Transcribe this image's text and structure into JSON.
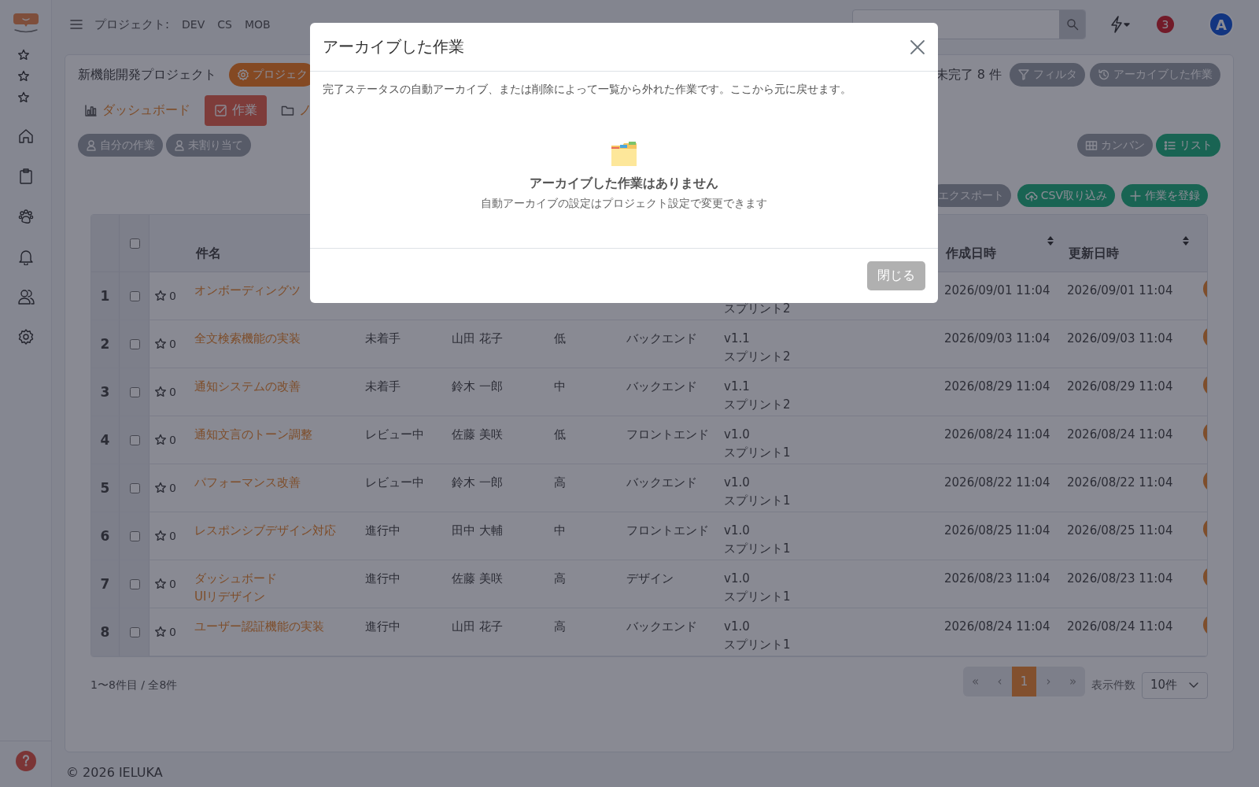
{
  "topbar": {
    "project_label": "プロジェクト:",
    "projects": [
      {
        "label": "DEV"
      },
      {
        "label": "CS"
      },
      {
        "label": "MOB"
      }
    ],
    "notifications": "3",
    "avatar": "A"
  },
  "project": {
    "title": "新機能開発プロジェクト",
    "settings_button": "プロジェク",
    "open_count": "未完了 8 件",
    "actions": [
      {
        "label": "フィルタ",
        "kind": "filter"
      },
      {
        "label": "アーカイブした作業",
        "kind": "archive"
      }
    ]
  },
  "tabs": [
    {
      "label": "ダッシュボード",
      "selected": false
    },
    {
      "label": "作業",
      "selected": true
    },
    {
      "label": "ノ",
      "selected": false
    }
  ],
  "filters": [
    {
      "label": "自分の作業"
    },
    {
      "label": "未割り当て"
    }
  ],
  "views": [
    {
      "label": "カンバン",
      "selected": false
    },
    {
      "label": "リスト",
      "selected": true
    }
  ],
  "toolbar": [
    {
      "label": "エクスポート",
      "kind": "export"
    },
    {
      "label": "CSV取り込み",
      "kind": "import"
    },
    {
      "label": "作業を登録",
      "kind": "create"
    }
  ],
  "table": {
    "header_checked": false,
    "columns": [
      {
        "label": "件名"
      },
      {
        "label": "作成日時",
        "sortable": true
      },
      {
        "label": "更新日時",
        "sortable": true
      }
    ],
    "rows": [
      {
        "number": "1",
        "checked": false,
        "favorites": "0",
        "title": "オンボーディングツ",
        "sprint": "スプリント2",
        "created": "2026/09/01 11:04",
        "updated": "2026/09/01 11:04"
      },
      {
        "number": "2",
        "checked": false,
        "favorites": "0",
        "title": "全文検索機能の実装",
        "status": "未着手",
        "assignee": "山田 花子",
        "priority": "低",
        "category": "バックエンド",
        "version": "v1.1",
        "sprint": "スプリント2",
        "created": "2026/09/03 11:04",
        "updated": "2026/09/03 11:04"
      },
      {
        "number": "3",
        "checked": false,
        "favorites": "0",
        "title": "通知システムの改善",
        "status": "未着手",
        "assignee": "鈴木 一郎",
        "priority": "中",
        "category": "バックエンド",
        "version": "v1.1",
        "sprint": "スプリント2",
        "created": "2026/08/29 11:04",
        "updated": "2026/08/29 11:04"
      },
      {
        "number": "4",
        "checked": false,
        "favorites": "0",
        "title": "通知文言のトーン調整",
        "status": "レビュー中",
        "assignee": "佐藤 美咲",
        "priority": "低",
        "category": "フロントエンド",
        "version": "v1.0",
        "sprint": "スプリント1",
        "created": "2026/08/24 11:04",
        "updated": "2026/08/24 11:04"
      },
      {
        "number": "5",
        "checked": false,
        "favorites": "0",
        "title": "パフォーマンス改善",
        "status": "レビュー中",
        "assignee": "鈴木 一郎",
        "priority": "高",
        "category": "バックエンド",
        "version": "v1.0",
        "sprint": "スプリント1",
        "created": "2026/08/22 11:04",
        "updated": "2026/08/22 11:04"
      },
      {
        "number": "6",
        "checked": false,
        "favorites": "0",
        "title": "レスポンシブデザイン対応",
        "status": "進行中",
        "assignee": "田中 大輔",
        "priority": "中",
        "category": "フロントエンド",
        "version": "v1.0",
        "sprint": "スプリント1",
        "created": "2026/08/25 11:04",
        "updated": "2026/08/25 11:04"
      },
      {
        "number": "7",
        "checked": false,
        "favorites": "0",
        "title": "ダッシュボード\nUIリデザイン",
        "status": "進行中",
        "assignee": "佐藤 美咲",
        "priority": "高",
        "category": "デザイン",
        "version": "v1.0",
        "sprint": "スプリント1",
        "created": "2026/08/23 11:04",
        "updated": "2026/08/23 11:04"
      },
      {
        "number": "8",
        "checked": false,
        "favorites": "0",
        "title": "ユーザー認証機能の実装",
        "status": "進行中",
        "assignee": "山田 花子",
        "priority": "高",
        "category": "バックエンド",
        "version": "v1.0",
        "sprint": "スプリント1",
        "created": "2026/08/24 11:04",
        "updated": "2026/08/24 11:04"
      }
    ],
    "summary": "1〜8件目 / 全8件",
    "pages": [
      {
        "label": "«",
        "selected": false
      },
      {
        "label": "‹",
        "selected": false
      },
      {
        "label": "1",
        "selected": true
      },
      {
        "label": "›",
        "selected": false
      },
      {
        "label": "»",
        "selected": false
      }
    ],
    "page_size_label": "表示件数",
    "page_size": "10件"
  },
  "footer": "© 2026 IELUKA",
  "modal": {
    "title": "アーカイブした作業",
    "description": "完了ステータスの自動アーカイブ、または削除によって一覧から外れた作業です。ここから元に戻せます。",
    "empty_title": "アーカイブした作業はありません",
    "empty_hint": "自動アーカイブの設定はプロジェクト設定で変更できます",
    "close_button": "閉じる"
  }
}
